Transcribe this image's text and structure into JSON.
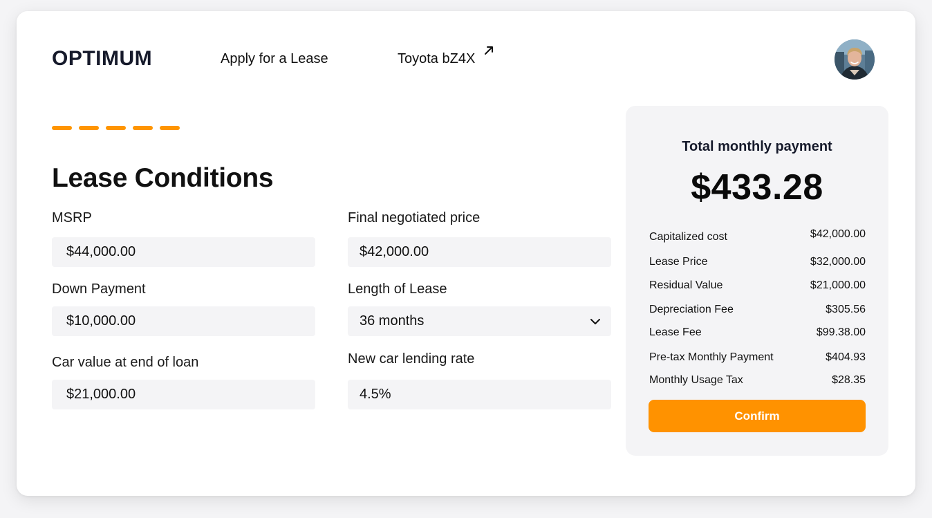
{
  "header": {
    "logo": "OPTIMUM",
    "nav": {
      "apply": "Apply for a Lease",
      "car": "Toyota bZ4X"
    }
  },
  "progress": {
    "steps": 5
  },
  "colors": {
    "accent": "#ff9500",
    "field_bg": "#f4f4f6",
    "text": "#111111"
  },
  "form": {
    "title": "Lease Conditions",
    "msrp": {
      "label": "MSRP",
      "value": "$44,000.00"
    },
    "final_price": {
      "label": "Final negotiated price",
      "value": "$42,000.00"
    },
    "down_payment": {
      "label": "Down Payment",
      "value": "$10,000.00"
    },
    "length": {
      "label": "Length of Lease",
      "value": "36 months"
    },
    "car_value": {
      "label": "Car value at end of loan",
      "value": "$21,000.00"
    },
    "rate": {
      "label": "New car lending rate",
      "value": "4.5%"
    }
  },
  "summary": {
    "title": "Total monthly payment",
    "total": "$433.28",
    "rows": [
      {
        "label": "Capitalized cost",
        "value": "$42,000.00"
      },
      {
        "label": "Lease Price",
        "value": "$32,000.00"
      },
      {
        "label": "Residual Value",
        "value": "$21,000.00"
      },
      {
        "label": "Depreciation Fee",
        "value": "$305.56"
      },
      {
        "label": "Lease Fee",
        "value": "$99.38.00"
      },
      {
        "label": "Pre-tax Monthly Payment",
        "value": "$404.93"
      },
      {
        "label": "Monthly Usage Tax",
        "value": "$28.35"
      }
    ],
    "confirm_label": "Confirm"
  },
  "icons": {
    "external": "external-link-icon",
    "chevron": "chevron-down-icon",
    "avatar": "user-avatar"
  }
}
